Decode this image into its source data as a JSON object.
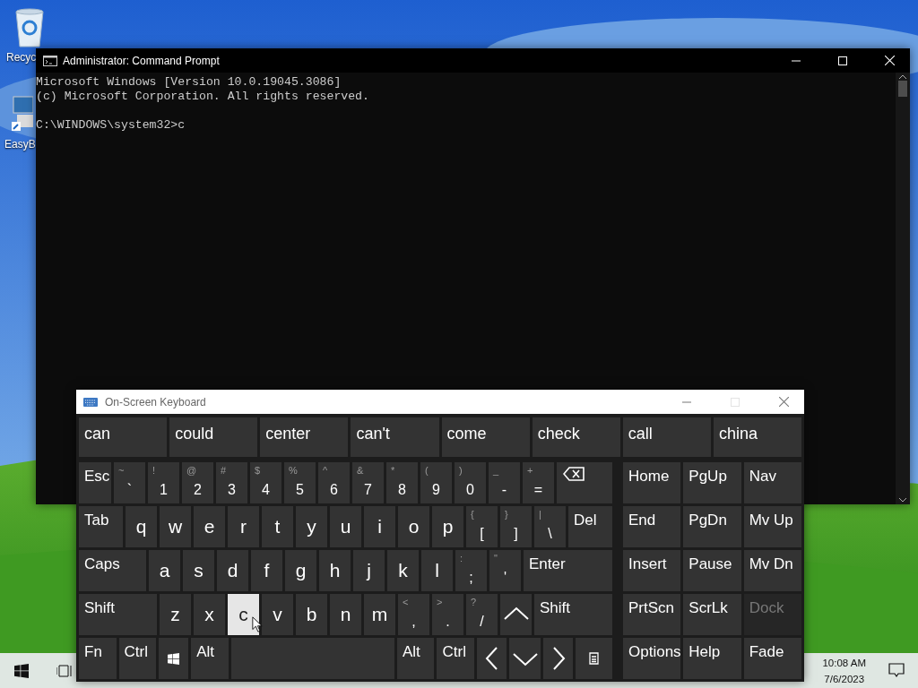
{
  "desktop_icons": [
    {
      "kind": "recycle",
      "label": "Recyc"
    },
    {
      "kind": "computer",
      "label": "EasyB"
    }
  ],
  "console_window": {
    "title": "Administrator:  Command Prompt",
    "output": [
      "Microsoft Windows [Version 10.0.19045.3086]",
      "(c) Microsoft Corporation. All rights reserved."
    ],
    "prompt_line": "C:\\WINDOWS\\system32>c"
  },
  "keyboard_window": {
    "title": "On-Screen Keyboard",
    "controls": [
      {
        "kind": "minimize",
        "disabled": false
      },
      {
        "kind": "maximize",
        "disabled": true
      },
      {
        "kind": "close",
        "disabled": false
      }
    ],
    "predictions": [
      "can",
      "could",
      "center",
      "can't",
      "come",
      "check",
      "call",
      "china"
    ],
    "main_rows": [
      {
        "keys": [
          {
            "kind": "control",
            "label": "Esc",
            "hovered": false,
            "disabled": false
          },
          {
            "kind": "symbol",
            "shift": "~",
            "label": "`",
            "hovered": false,
            "disabled": false
          },
          {
            "kind": "symbol",
            "shift": "!",
            "label": "1",
            "hovered": false,
            "disabled": false
          },
          {
            "kind": "symbol",
            "shift": "@",
            "label": "2",
            "hovered": false,
            "disabled": false
          },
          {
            "kind": "symbol",
            "shift": "#",
            "label": "3",
            "hovered": false,
            "disabled": false
          },
          {
            "kind": "symbol",
            "shift": "$",
            "label": "4",
            "hovered": false,
            "disabled": false
          },
          {
            "kind": "symbol",
            "shift": "%",
            "label": "5",
            "hovered": false,
            "disabled": false
          },
          {
            "kind": "symbol",
            "shift": "^",
            "label": "6",
            "hovered": false,
            "disabled": false
          },
          {
            "kind": "symbol",
            "shift": "&",
            "label": "7",
            "hovered": false,
            "disabled": false
          },
          {
            "kind": "symbol",
            "shift": "*",
            "label": "8",
            "hovered": false,
            "disabled": false
          },
          {
            "kind": "symbol",
            "shift": "(",
            "label": "9",
            "hovered": false,
            "disabled": false
          },
          {
            "kind": "symbol",
            "shift": ")",
            "label": "0",
            "hovered": false,
            "disabled": false
          },
          {
            "kind": "symbol",
            "shift": "_",
            "label": "-",
            "hovered": false,
            "disabled": false
          },
          {
            "kind": "symbol",
            "shift": "+",
            "label": "=",
            "hovered": false,
            "disabled": false
          },
          {
            "kind": "backspace",
            "hovered": false,
            "disabled": false
          }
        ]
      },
      {
        "keys": [
          {
            "kind": "control",
            "label": "Tab",
            "hovered": false,
            "disabled": false
          },
          {
            "kind": "char",
            "label": "q",
            "hovered": false,
            "disabled": false
          },
          {
            "kind": "char",
            "label": "w",
            "hovered": false,
            "disabled": false
          },
          {
            "kind": "char",
            "label": "e",
            "hovered": false,
            "disabled": false
          },
          {
            "kind": "char",
            "label": "r",
            "hovered": false,
            "disabled": false
          },
          {
            "kind": "char",
            "label": "t",
            "hovered": false,
            "disabled": false
          },
          {
            "kind": "char",
            "label": "y",
            "hovered": false,
            "disabled": false
          },
          {
            "kind": "char",
            "label": "u",
            "hovered": false,
            "disabled": false
          },
          {
            "kind": "char",
            "label": "i",
            "hovered": false,
            "disabled": false
          },
          {
            "kind": "char",
            "label": "o",
            "hovered": false,
            "disabled": false
          },
          {
            "kind": "char",
            "label": "p",
            "hovered": false,
            "disabled": false
          },
          {
            "kind": "symbol",
            "shift": "{",
            "label": "[",
            "hovered": false,
            "disabled": false
          },
          {
            "kind": "symbol",
            "shift": "}",
            "label": "]",
            "hovered": false,
            "disabled": false
          },
          {
            "kind": "symbol",
            "shift": "|",
            "label": "\\",
            "hovered": false,
            "disabled": false
          },
          {
            "kind": "control",
            "label": "Del",
            "hovered": false,
            "disabled": false
          }
        ]
      },
      {
        "keys": [
          {
            "kind": "control",
            "label": "Caps",
            "hovered": false,
            "disabled": false
          },
          {
            "kind": "char",
            "label": "a",
            "hovered": false,
            "disabled": false
          },
          {
            "kind": "char",
            "label": "s",
            "hovered": false,
            "disabled": false
          },
          {
            "kind": "char",
            "label": "d",
            "hovered": false,
            "disabled": false
          },
          {
            "kind": "char",
            "label": "f",
            "hovered": false,
            "disabled": false
          },
          {
            "kind": "char",
            "label": "g",
            "hovered": false,
            "disabled": false
          },
          {
            "kind": "char",
            "label": "h",
            "hovered": false,
            "disabled": false
          },
          {
            "kind": "char",
            "label": "j",
            "hovered": false,
            "disabled": false
          },
          {
            "kind": "char",
            "label": "k",
            "hovered": false,
            "disabled": false
          },
          {
            "kind": "char",
            "label": "l",
            "hovered": false,
            "disabled": false
          },
          {
            "kind": "symbol",
            "shift": ":",
            "label": ";",
            "hovered": false,
            "disabled": false
          },
          {
            "kind": "symbol",
            "shift": "\"",
            "label": "'",
            "hovered": false,
            "disabled": false
          },
          {
            "kind": "wide",
            "label": "Enter",
            "hovered": false,
            "disabled": false
          }
        ]
      },
      {
        "keys": [
          {
            "kind": "wide",
            "label": "Shift",
            "hovered": false,
            "disabled": false
          },
          {
            "kind": "char",
            "label": "z",
            "hovered": false,
            "disabled": false
          },
          {
            "kind": "char",
            "label": "x",
            "hovered": false,
            "disabled": false
          },
          {
            "kind": "char",
            "label": "c",
            "hovered": true,
            "disabled": false
          },
          {
            "kind": "char",
            "label": "v",
            "hovered": false,
            "disabled": false
          },
          {
            "kind": "char",
            "label": "b",
            "hovered": false,
            "disabled": false
          },
          {
            "kind": "char",
            "label": "n",
            "hovered": false,
            "disabled": false
          },
          {
            "kind": "char",
            "label": "m",
            "hovered": false,
            "disabled": false
          },
          {
            "kind": "symbol",
            "shift": "<",
            "label": ",",
            "hovered": false,
            "disabled": false
          },
          {
            "kind": "symbol",
            "shift": ">",
            "label": ".",
            "hovered": false,
            "disabled": false
          },
          {
            "kind": "symbol",
            "shift": "?",
            "label": "/",
            "hovered": false,
            "disabled": false
          },
          {
            "kind": "up",
            "hovered": false,
            "disabled": false
          },
          {
            "kind": "wide",
            "label": "Shift",
            "hovered": false,
            "disabled": false
          }
        ]
      },
      {
        "keys": [
          {
            "kind": "control",
            "label": "Fn",
            "hovered": false,
            "disabled": false
          },
          {
            "kind": "control",
            "label": "Ctrl",
            "hovered": false,
            "disabled": false
          },
          {
            "kind": "windows",
            "hovered": false,
            "disabled": false
          },
          {
            "kind": "control",
            "label": "Alt",
            "hovered": false,
            "disabled": false
          },
          {
            "kind": "space",
            "hovered": false,
            "disabled": false
          },
          {
            "kind": "control",
            "label": "Alt",
            "hovered": false,
            "disabled": false
          },
          {
            "kind": "control",
            "label": "Ctrl",
            "hovered": false,
            "disabled": false
          },
          {
            "kind": "left",
            "hovered": false,
            "disabled": false
          },
          {
            "kind": "down",
            "hovered": false,
            "disabled": false
          },
          {
            "kind": "right",
            "hovered": false,
            "disabled": false
          },
          {
            "kind": "menu",
            "hovered": false,
            "disabled": false
          }
        ]
      }
    ],
    "nav_rows": [
      {
        "keys": [
          {
            "label": "Home",
            "disabled": false
          },
          {
            "label": "PgUp",
            "disabled": false
          },
          {
            "label": "Nav",
            "disabled": false
          }
        ]
      },
      {
        "keys": [
          {
            "label": "End",
            "disabled": false
          },
          {
            "label": "PgDn",
            "disabled": false
          },
          {
            "label": "Mv Up",
            "disabled": false
          }
        ]
      },
      {
        "keys": [
          {
            "label": "Insert",
            "disabled": false
          },
          {
            "label": "Pause",
            "disabled": false
          },
          {
            "label": "Mv Dn",
            "disabled": false
          }
        ]
      },
      {
        "keys": [
          {
            "label": "PrtScn",
            "disabled": false
          },
          {
            "label": "ScrLk",
            "disabled": false
          },
          {
            "label": "Dock",
            "disabled": true
          }
        ]
      },
      {
        "keys": [
          {
            "label": "Options",
            "disabled": false
          },
          {
            "label": "Help",
            "disabled": false
          },
          {
            "label": "Fade",
            "disabled": false
          }
        ]
      }
    ]
  },
  "taskbar": {
    "time": "10:08 AM",
    "date": "7/6/2023"
  }
}
